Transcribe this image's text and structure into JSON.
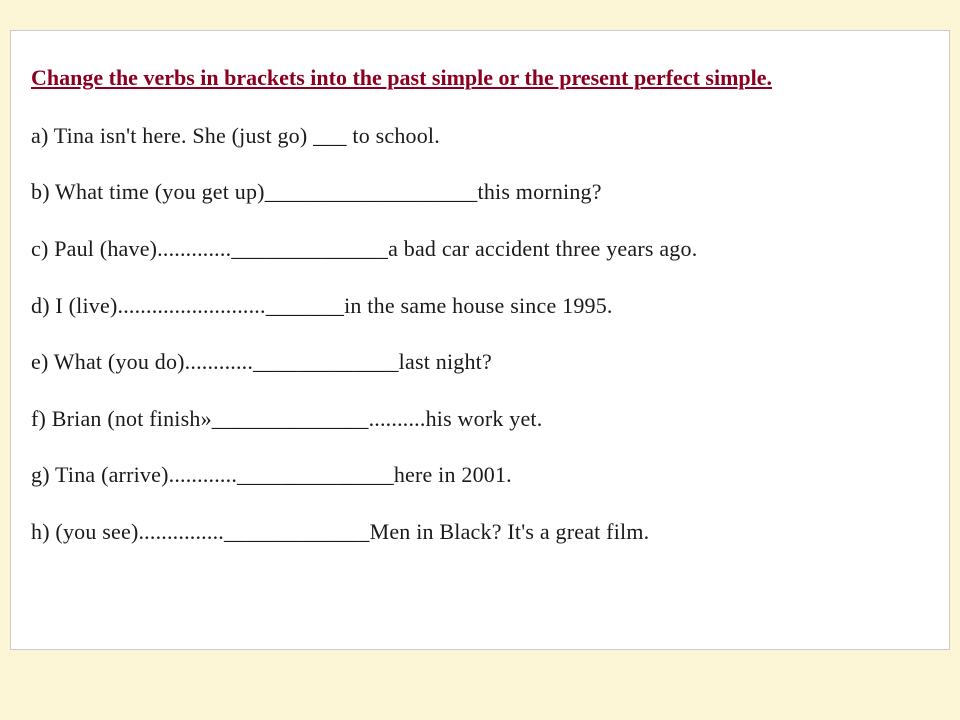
{
  "worksheet": {
    "instruction": "Change the verbs in brackets into the past simple or the present perfect simple.",
    "exercises": {
      "a": "a)  Tina isn't here. She (just go)       ___    to school.",
      "b": "b)  What time (you get up)___________________this morning?",
      "c": "c)  Paul (have).............______________a bad car accident three years ago.",
      "d": "d)  I (live).........................._______in the same house since 1995.",
      "e": "e)  What (you do)............_____________last night?",
      "f": "f)    Brian (not finish»______________..........his work yet.",
      "g": "g)  Tina (arrive)............______________here in 2001.",
      "h": "h) (you see)..............._____________Men in Black? It's a great film."
    }
  }
}
